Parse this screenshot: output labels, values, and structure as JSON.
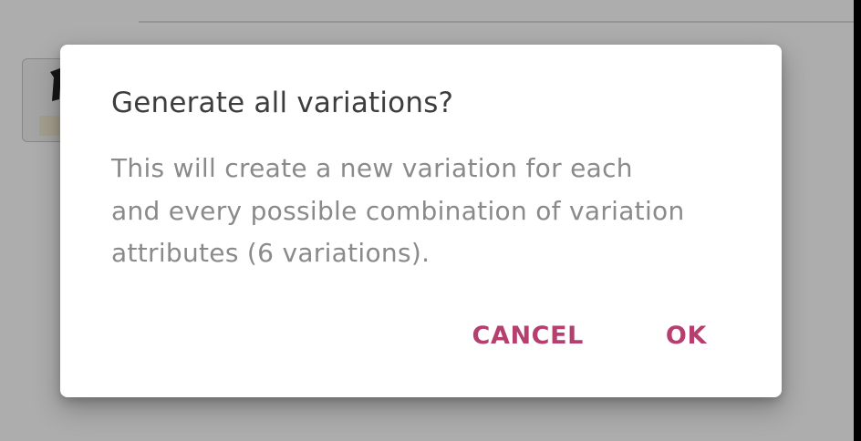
{
  "dialog": {
    "title": "Generate all variations?",
    "message_lines": [
      "This will create a new variation for each",
      "and every possible combination of variation",
      "attributes (6 variations)."
    ],
    "cancel_label": "CANCEL",
    "ok_label": "OK"
  },
  "colors": {
    "accent": "#b53f6e",
    "scrim": "rgba(0,0,0,0.32)",
    "title_text": "#3d3d3d",
    "message_text": "#8a8a8a"
  },
  "icons": {
    "background_thumbnail": "product-thumbnail-icon"
  }
}
